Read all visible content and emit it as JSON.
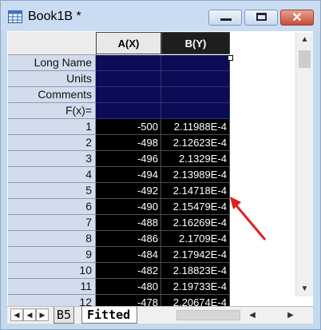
{
  "window": {
    "title": "Book1B *",
    "close_glyph": "✕"
  },
  "columns": {
    "a": "A(X)",
    "b": "B(Y)"
  },
  "meta_labels": [
    "Long Name",
    "Units",
    "Comments",
    "F(x)="
  ],
  "rows": [
    {
      "n": "1",
      "a": "-500",
      "b": "2.11988E-4"
    },
    {
      "n": "2",
      "a": "-498",
      "b": "2.12623E-4"
    },
    {
      "n": "3",
      "a": "-496",
      "b": "2.1329E-4"
    },
    {
      "n": "4",
      "a": "-494",
      "b": "2.13989E-4"
    },
    {
      "n": "5",
      "a": "-492",
      "b": "2.14718E-4"
    },
    {
      "n": "6",
      "a": "-490",
      "b": "2.15479E-4"
    },
    {
      "n": "7",
      "a": "-488",
      "b": "2.16269E-4"
    },
    {
      "n": "8",
      "a": "-486",
      "b": "2.1709E-4"
    },
    {
      "n": "9",
      "a": "-484",
      "b": "2.17942E-4"
    },
    {
      "n": "10",
      "a": "-482",
      "b": "2.18823E-4"
    },
    {
      "n": "11",
      "a": "-480",
      "b": "2.19733E-4"
    },
    {
      "n": "12",
      "a": "-478",
      "b": "2.20674E-4"
    }
  ],
  "tabs": {
    "sheet1": "B5",
    "sheet2": "Fitted"
  },
  "nav": {
    "first": "◀",
    "last": "▶"
  },
  "icons": {
    "app": "workbook-icon",
    "arrow": "annotation-arrow-icon"
  },
  "colors": {
    "selection": "#0b0c55",
    "cells": "#000000",
    "arrow": "#e02020"
  }
}
